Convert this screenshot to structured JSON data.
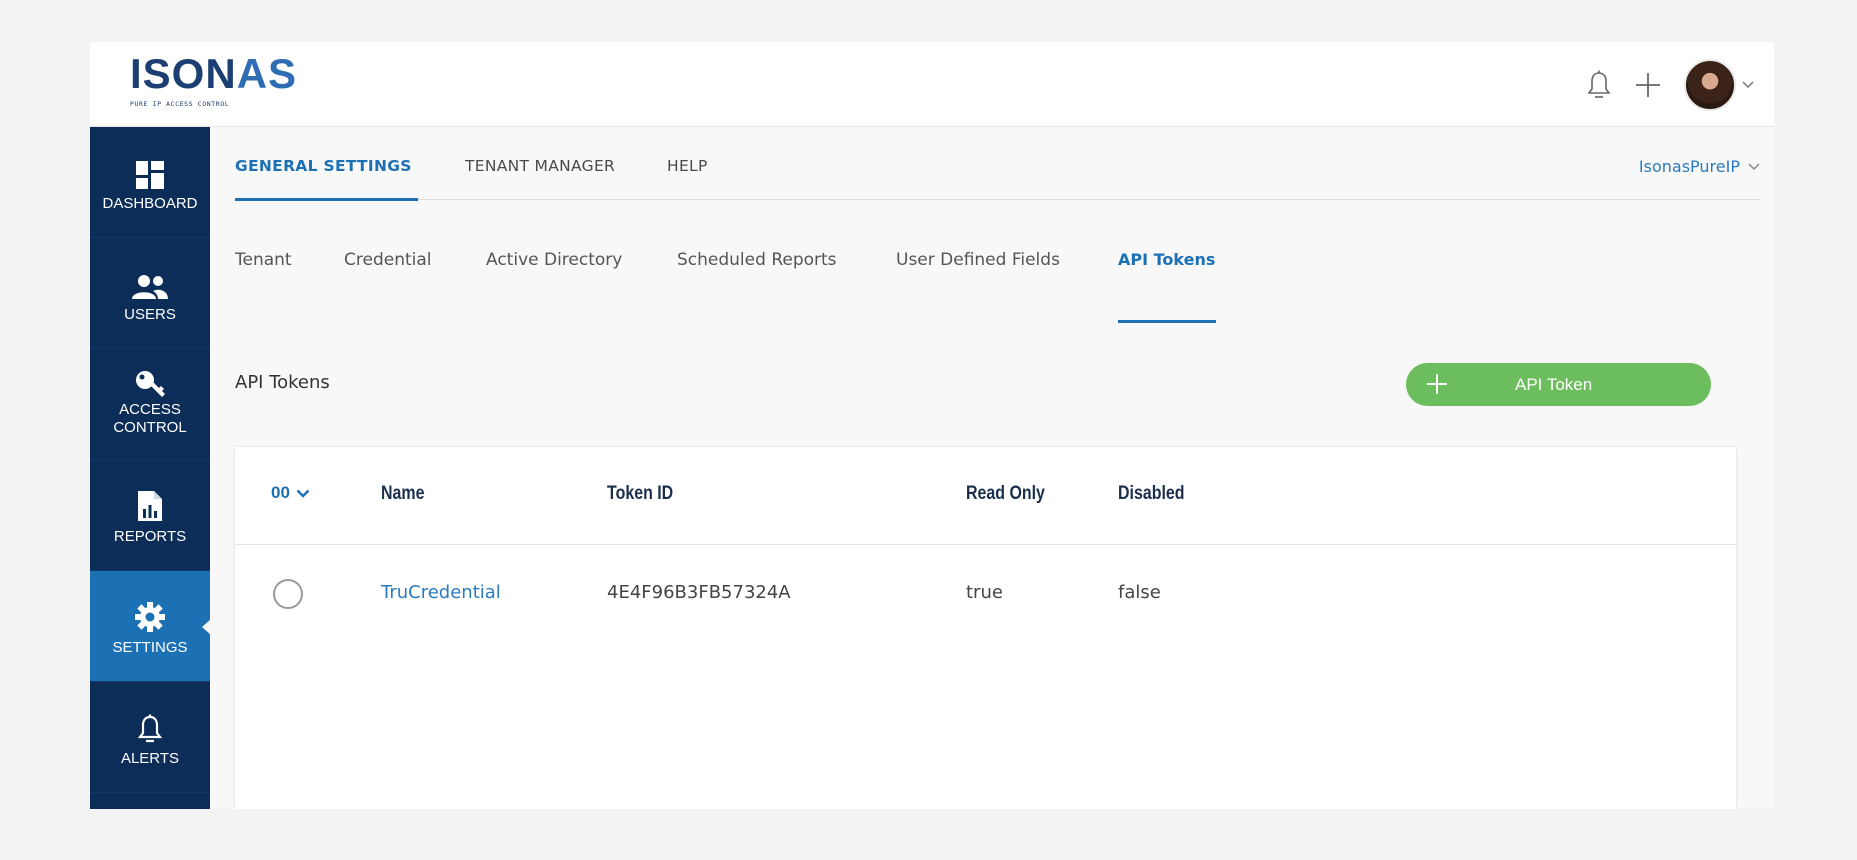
{
  "brand": {
    "logo_text_a": "ISON",
    "logo_text_b": "AS",
    "tagline": "PURE IP ACCESS CONTROL"
  },
  "header": {
    "icons": [
      "bell-icon",
      "plus-icon",
      "avatar",
      "chevron-down-icon"
    ]
  },
  "sidebar": {
    "items": [
      {
        "label": "DASHBOARD",
        "icon": "dashboard-icon"
      },
      {
        "label": "USERS",
        "icon": "users-icon"
      },
      {
        "label": "ACCESS CONTROL",
        "icon": "key-icon"
      },
      {
        "label": "REPORTS",
        "icon": "report-icon"
      },
      {
        "label": "SETTINGS",
        "icon": "gear-icon",
        "active": true
      },
      {
        "label": "ALERTS",
        "icon": "bell-icon"
      }
    ]
  },
  "tabs": [
    {
      "label": "GENERAL SETTINGS",
      "active": true
    },
    {
      "label": "TENANT MANAGER"
    },
    {
      "label": "HELP"
    }
  ],
  "tenant_selector": {
    "value": "IsonasPureIP"
  },
  "subtabs": [
    {
      "label": "Tenant"
    },
    {
      "label": "Credential"
    },
    {
      "label": "Active Directory"
    },
    {
      "label": "Scheduled Reports"
    },
    {
      "label": "User Defined Fields"
    },
    {
      "label": "API Tokens",
      "active": true
    }
  ],
  "section": {
    "title": "API Tokens",
    "add_button_label": "API Token"
  },
  "table": {
    "sort_label": "00",
    "columns": [
      "Name",
      "Token ID",
      "Read Only",
      "Disabled"
    ],
    "rows": [
      {
        "name": "TruCredential",
        "token_id": "4E4F96B3FB57324A",
        "read_only": "true",
        "disabled": "false"
      }
    ]
  },
  "colors": {
    "sidebar_bg": "#0c2d57",
    "sidebar_active": "#1c70b4",
    "accent": "#1c70b4",
    "button_green": "#6cbd5d"
  }
}
